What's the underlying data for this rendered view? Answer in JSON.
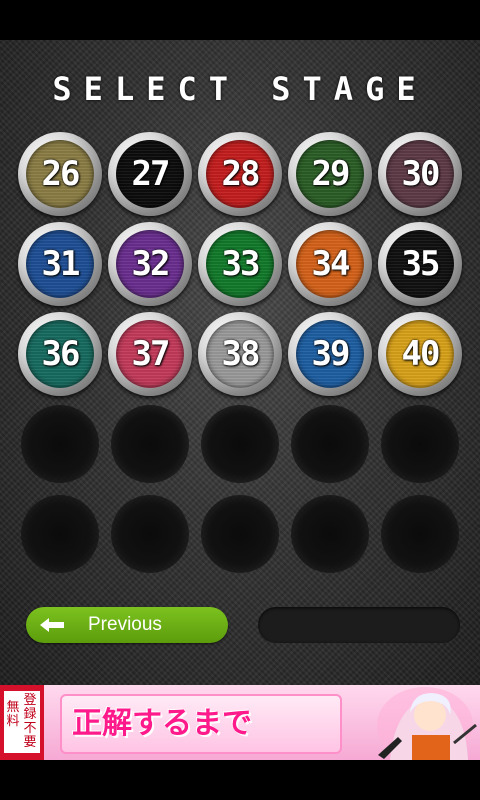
{
  "title": "SELECT STAGE",
  "stages": [
    {
      "number": "26",
      "color": "#8b7d45"
    },
    {
      "number": "27",
      "color": "#0d0d0d"
    },
    {
      "number": "28",
      "color": "#c41e1e"
    },
    {
      "number": "29",
      "color": "#2b5e26"
    },
    {
      "number": "30",
      "color": "#5e3a47"
    },
    {
      "number": "31",
      "color": "#1e4f95"
    },
    {
      "number": "32",
      "color": "#6a2e8f"
    },
    {
      "number": "33",
      "color": "#127a2a"
    },
    {
      "number": "34",
      "color": "#d4621a"
    },
    {
      "number": "35",
      "color": "#111111"
    },
    {
      "number": "36",
      "color": "#176b60"
    },
    {
      "number": "37",
      "color": "#c23a5a"
    },
    {
      "number": "38",
      "color": "#9a9a9a"
    },
    {
      "number": "39",
      "color": "#1e5fa3"
    },
    {
      "number": "40",
      "color": "#d9a21a"
    }
  ],
  "locked_slots": 10,
  "navigation": {
    "previous_label": "Previous",
    "next_label": ""
  },
  "ad": {
    "badge_left": "無\n料",
    "badge_right": "登\n録\n不\n要",
    "text": "正解するまで"
  }
}
